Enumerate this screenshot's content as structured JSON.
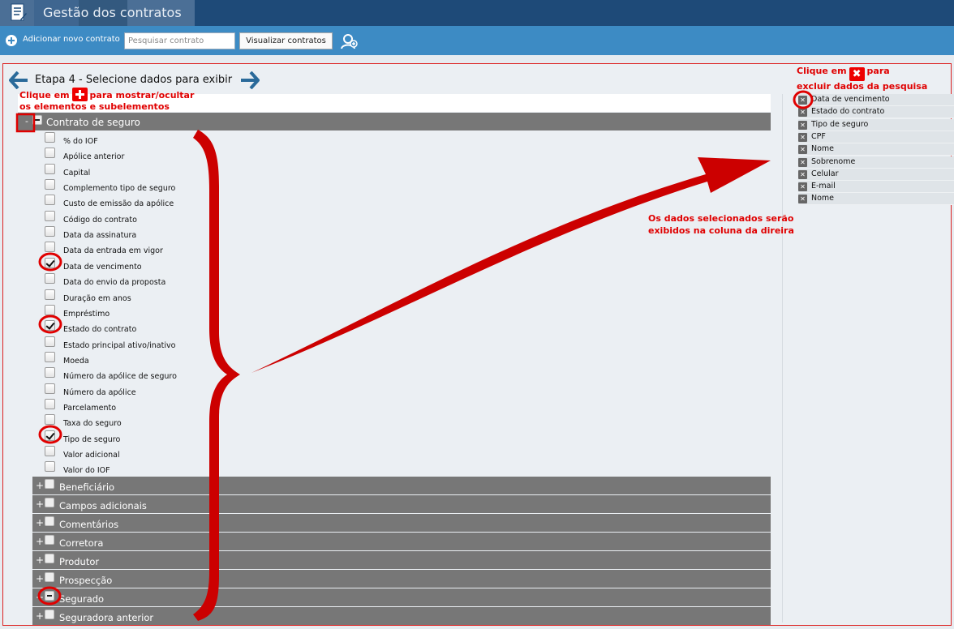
{
  "header": {
    "title": "Gestão dos contratos"
  },
  "toolbar": {
    "add_label": "Adicionar novo contrato",
    "search_placeholder": "Pesquisar contrato",
    "view_button": "Visualizar contratos"
  },
  "step": {
    "title": "Etapa 4 - Selecione dados para exibir"
  },
  "hints": {
    "toggle_line1_pre": "Clique em",
    "toggle_line1_post": "para mostrar/ocultar",
    "toggle_line2": "os elementos e subelementos",
    "remove_line1_pre": "Clique em",
    "remove_line1_post": "para",
    "remove_line2": "excluir dados da pesquisa",
    "info_line1": "Os dados selecionados serão",
    "info_line2": "exibidos na coluna da direira"
  },
  "group": {
    "collapse_symbol": "-",
    "label": "Contrato de seguro",
    "items": [
      {
        "label": "% do IOF",
        "checked": false
      },
      {
        "label": "Apólice anterior",
        "checked": false
      },
      {
        "label": "Capital",
        "checked": false
      },
      {
        "label": "Complemento tipo de seguro",
        "checked": false
      },
      {
        "label": "Custo de emissão da apólice",
        "checked": false
      },
      {
        "label": "Código do contrato",
        "checked": false
      },
      {
        "label": "Data da assinatura",
        "checked": false
      },
      {
        "label": "Data da entrada em vigor",
        "checked": false
      },
      {
        "label": "Data de vencimento",
        "checked": true
      },
      {
        "label": "Data do envio da proposta",
        "checked": false
      },
      {
        "label": "Duração em anos",
        "checked": false
      },
      {
        "label": "Empréstimo",
        "checked": false
      },
      {
        "label": "Estado do contrato",
        "checked": true
      },
      {
        "label": "Estado principal ativo/inativo",
        "checked": false
      },
      {
        "label": "Moeda",
        "checked": false
      },
      {
        "label": "Número da apólice de seguro",
        "checked": false
      },
      {
        "label": "Número da apólice",
        "checked": false
      },
      {
        "label": "Parcelamento",
        "checked": false
      },
      {
        "label": "Taxa do seguro",
        "checked": false
      },
      {
        "label": "Tipo de seguro",
        "checked": true
      },
      {
        "label": "Valor adicional",
        "checked": false
      },
      {
        "label": "Valor do IOF",
        "checked": false
      }
    ]
  },
  "sections": [
    {
      "label": "Beneficiário",
      "expand_symbol": "+",
      "partial": false
    },
    {
      "label": "Campos adicionais",
      "expand_symbol": "+",
      "partial": false
    },
    {
      "label": "Comentários",
      "expand_symbol": "+",
      "partial": false
    },
    {
      "label": "Corretora",
      "expand_symbol": "+",
      "partial": false
    },
    {
      "label": "Produtor",
      "expand_symbol": "+",
      "partial": false
    },
    {
      "label": "Prospecção",
      "expand_symbol": "+",
      "partial": false
    },
    {
      "label": "Segurado",
      "expand_symbol": "+",
      "partial": true
    },
    {
      "label": "Seguradora anterior",
      "expand_symbol": "+",
      "partial": false
    }
  ],
  "selected": [
    "Data de vencimento",
    "Estado do contrato",
    "Tipo de seguro",
    "CPF",
    "Nome",
    "Sobrenome",
    "Celular",
    "E-mail",
    "Nome"
  ],
  "colors": {
    "header": "#1e4a78",
    "toolbar": "#3d8bc4",
    "annotation": "#e00000",
    "bar": "#777777"
  }
}
